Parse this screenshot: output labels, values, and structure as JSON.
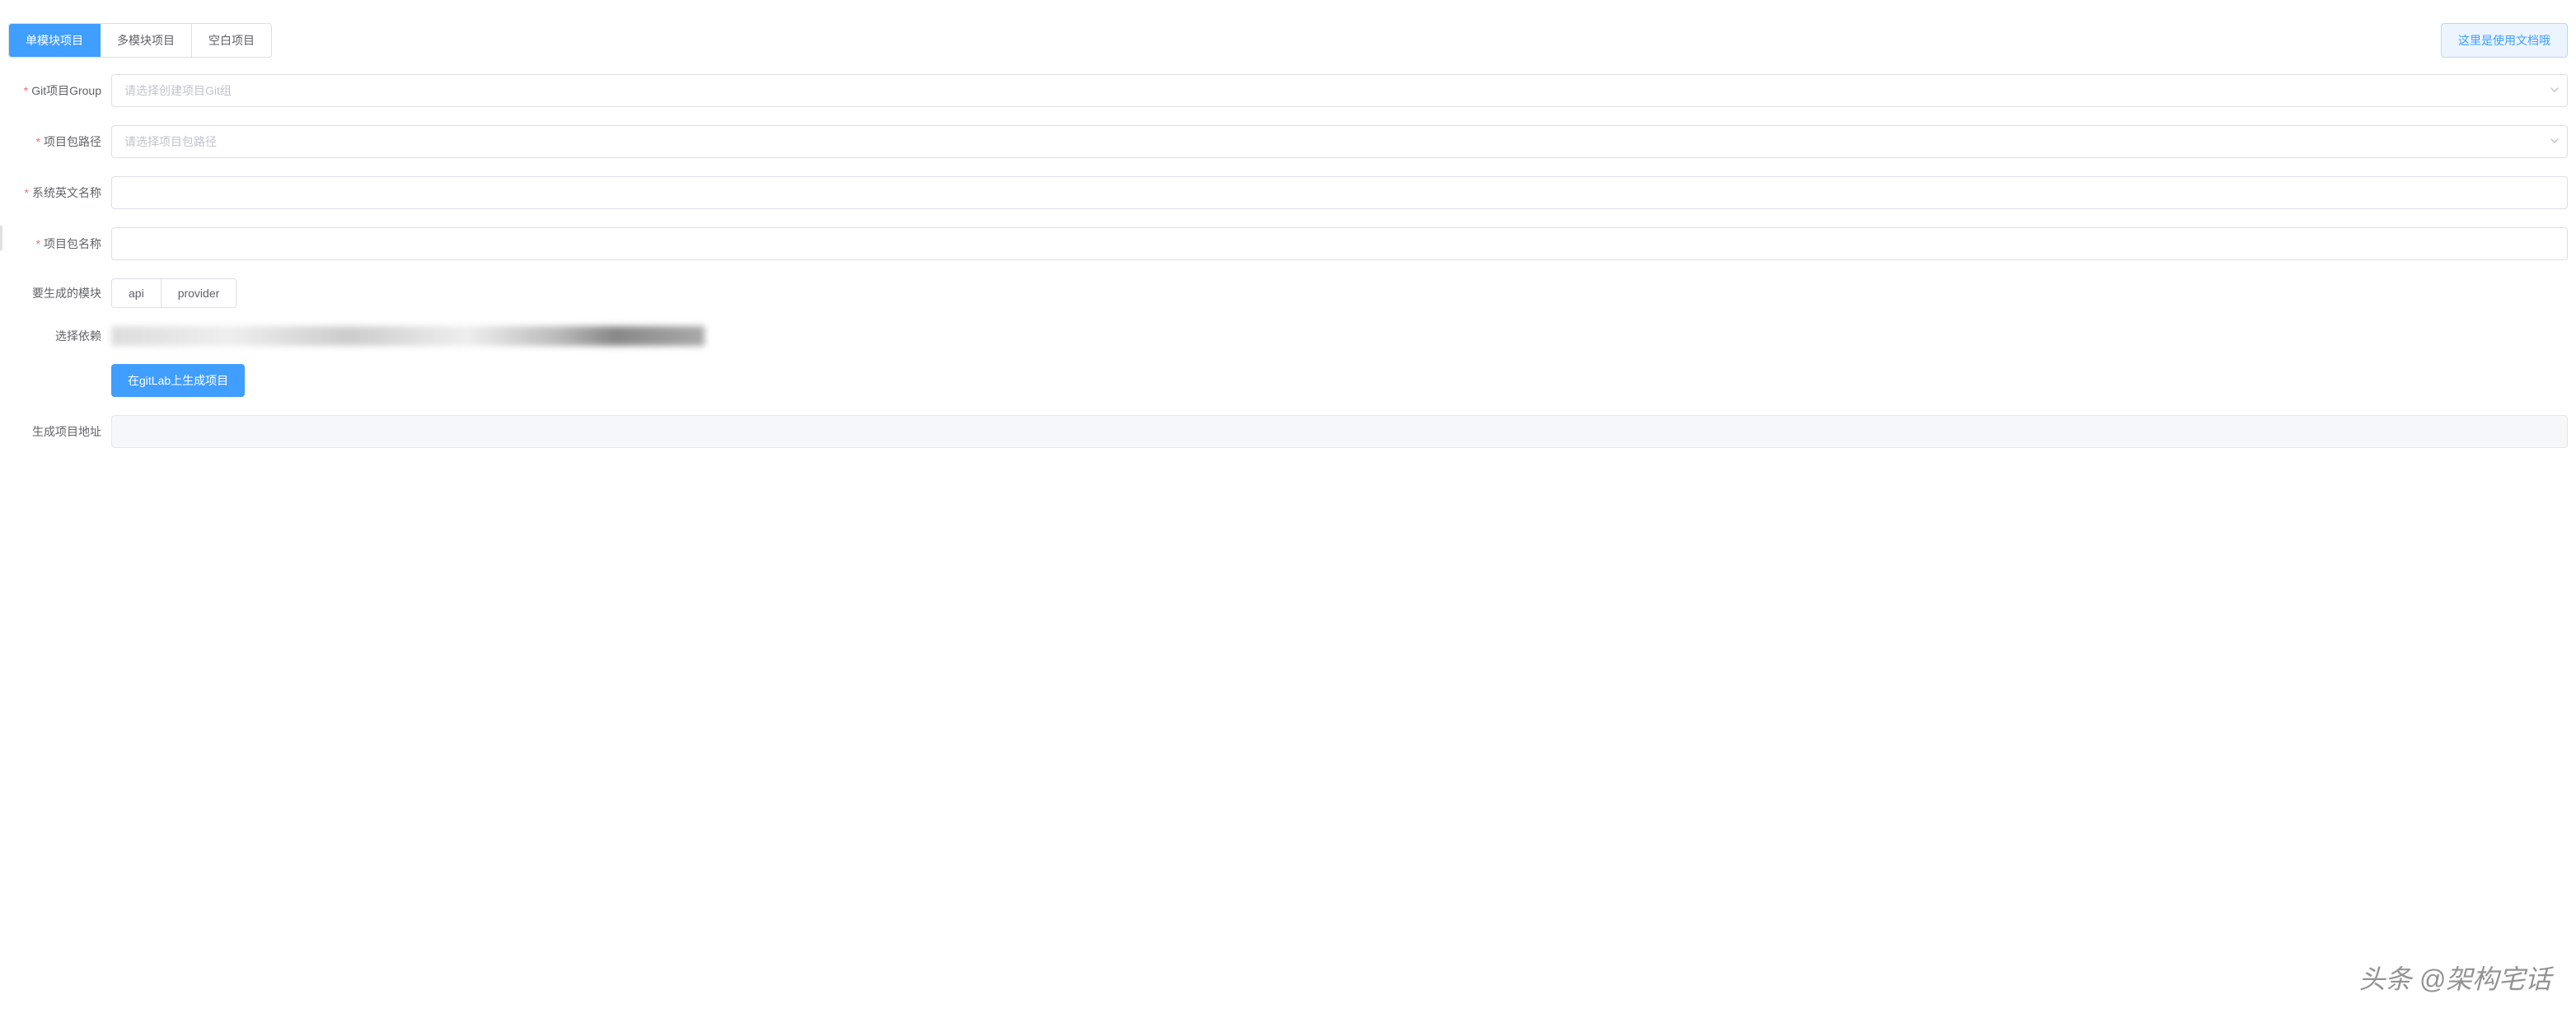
{
  "tabs": {
    "items": [
      {
        "label": "单模块项目",
        "active": true
      },
      {
        "label": "多模块项目",
        "active": false
      },
      {
        "label": "空白项目",
        "active": false
      }
    ]
  },
  "docLink": {
    "label": "这里是使用文档哦"
  },
  "form": {
    "gitGroup": {
      "label": "Git项目Group",
      "placeholder": "请选择创建项目Git组",
      "required": true
    },
    "packagePath": {
      "label": "项目包路径",
      "placeholder": "请选择项目包路径",
      "required": true
    },
    "sysEnName": {
      "label": "系统英文名称",
      "value": "",
      "required": true
    },
    "packageName": {
      "label": "项目包名称",
      "value": "",
      "required": true
    },
    "modules": {
      "label": "要生成的模块",
      "options": [
        {
          "label": "api"
        },
        {
          "label": "provider"
        }
      ]
    },
    "dependencies": {
      "label": "选择依赖"
    },
    "submit": {
      "label": "在gitLab上生成项目"
    },
    "resultAddr": {
      "label": "生成项目地址",
      "value": ""
    }
  },
  "watermark": "头条 @架构宅话"
}
